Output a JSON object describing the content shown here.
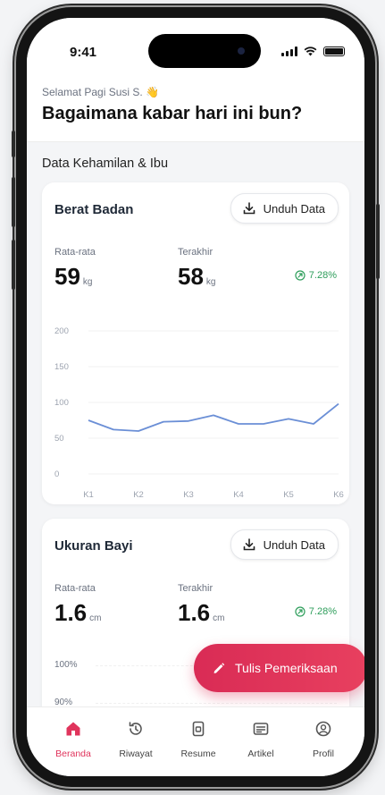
{
  "status_bar": {
    "time": "9:41"
  },
  "header": {
    "greeting": "Selamat Pagi Susi S. 👋",
    "question": "Bagaimana kabar hari ini bun?"
  },
  "section_title": "Data Kehamilan & Ibu",
  "weight_card": {
    "title": "Berat Badan",
    "download_label": "Unduh Data",
    "avg_label": "Rata-rata",
    "avg_value": "59",
    "avg_unit": "kg",
    "last_label": "Terakhir",
    "last_value": "58",
    "last_unit": "kg",
    "change": "7.28%",
    "chart": {
      "y_ticks": [
        "200",
        "150",
        "100",
        "50",
        "0"
      ],
      "x_labels": [
        "K1",
        "K2",
        "K3",
        "K4",
        "K5",
        "K6"
      ]
    }
  },
  "baby_card": {
    "title": "Ukuran Bayi",
    "download_label": "Unduh Data",
    "avg_label": "Rata-rata",
    "avg_value": "1.6",
    "avg_unit": "cm",
    "last_label": "Terakhir",
    "last_value": "1.6",
    "last_unit": "cm",
    "change": "7.28%",
    "y_ticks": [
      "100%",
      "90%"
    ]
  },
  "fab_label": "Tulis Pemeriksaan",
  "tabs": [
    {
      "label": "Beranda",
      "icon": "home-icon"
    },
    {
      "label": "Riwayat",
      "icon": "history-icon"
    },
    {
      "label": "Resume",
      "icon": "document-icon"
    },
    {
      "label": "Artikel",
      "icon": "article-icon"
    },
    {
      "label": "Profil",
      "icon": "profile-icon"
    }
  ],
  "colors": {
    "accent": "#e0345c",
    "line": "#6b8fd6",
    "positive": "#2e9e5b"
  },
  "chart_data": {
    "type": "line",
    "categories": [
      "K1",
      "K2",
      "K3",
      "K4",
      "K5",
      "K6"
    ],
    "x": [
      1,
      1.5,
      2,
      2.5,
      3,
      3.5,
      4,
      4.5,
      5,
      5.5,
      6
    ],
    "series": [
      {
        "values": [
          75,
          62,
          60,
          73,
          74,
          82,
          70,
          70,
          77,
          70,
          98
        ]
      }
    ],
    "ylim": [
      0,
      200
    ],
    "y_ticks": [
      0,
      50,
      100,
      150,
      200
    ],
    "grid": true
  }
}
